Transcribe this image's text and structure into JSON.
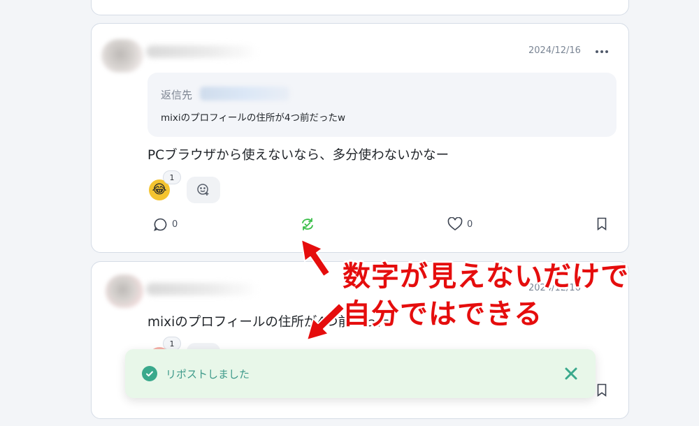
{
  "post_main": {
    "date": "2024/12/16",
    "reply_label": "返信先",
    "reply_text": "mixiのプロフィールの住所が4つ前だったw",
    "body": "PCブラウザから使えないなら、多分使わないかなー",
    "reaction": {
      "emoji": "😂",
      "count": "1"
    },
    "actions": {
      "comment_count": "0",
      "like_count": "0"
    },
    "colors": {
      "repost_active": "#3bbf4a"
    }
  },
  "post_next": {
    "date": "2024/12/16",
    "body": "mixiのプロフィールの住所が4つ前だった",
    "reaction": {
      "count": "1"
    }
  },
  "annotation": {
    "line1": "数字が見えないだけで",
    "line2": "自分ではできる",
    "color": "#e50d0d"
  },
  "toast": {
    "message": "リポストしました",
    "colors": {
      "background": "#e8f7e9",
      "accent": "#3aa98c"
    }
  }
}
